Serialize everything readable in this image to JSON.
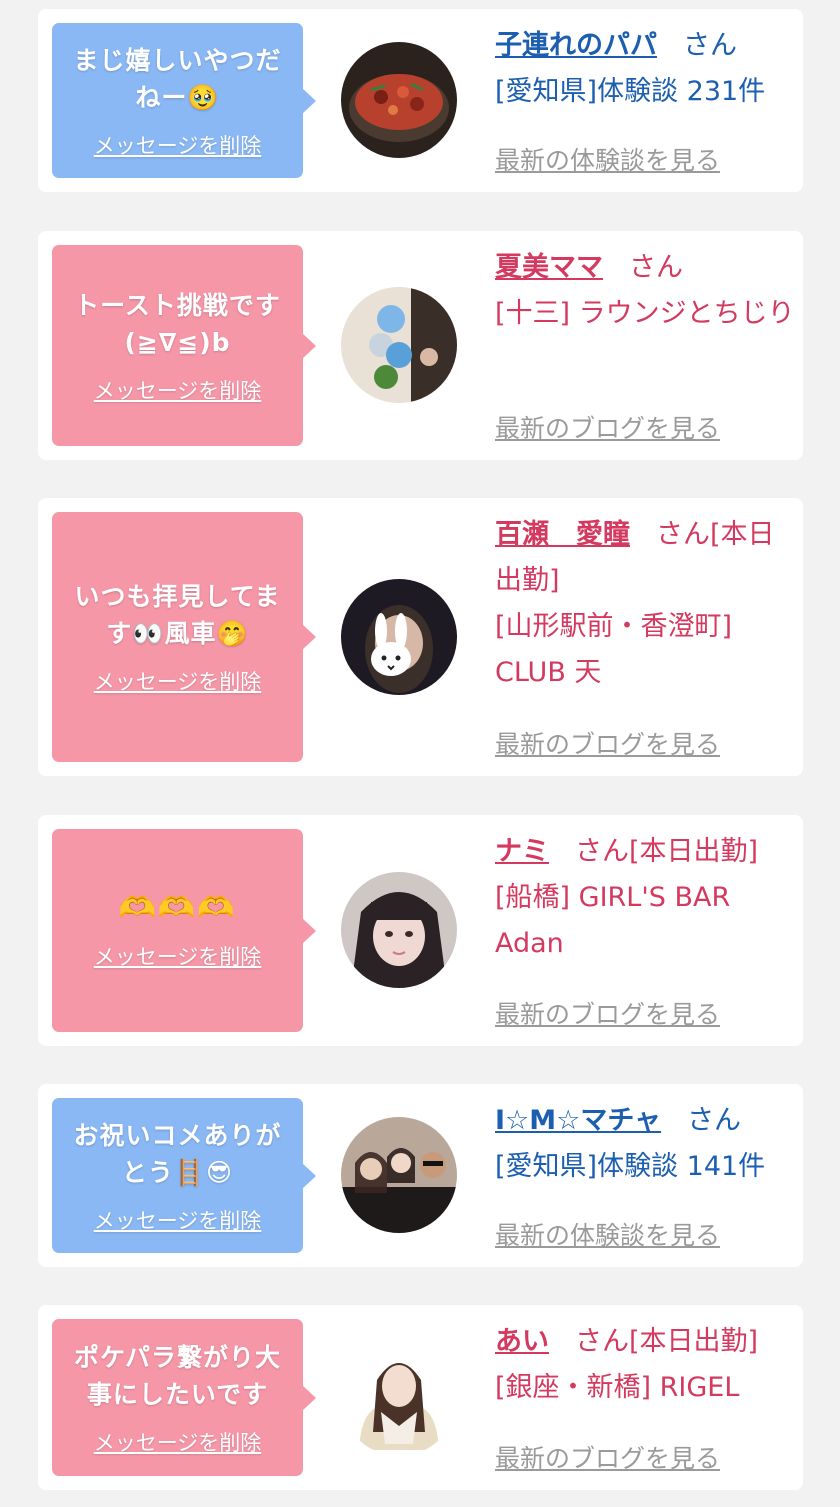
{
  "ui": {
    "delete_label": "メッセージを削除",
    "san": "さん"
  },
  "cards": [
    {
      "kind": "blue",
      "message": "まじ嬉しいやつだ\nねー🥹",
      "name": "子連れのパパ",
      "status": "",
      "sub": "[愛知県]体験談 231件",
      "latest_label": "最新の体験談を見る"
    },
    {
      "kind": "pink",
      "message": "トースト挑戦です\n(≧∇≦)b",
      "name": "夏美ママ",
      "status": "",
      "sub": "[十三] ラウンジとちじり",
      "latest_label": "最新のブログを見る"
    },
    {
      "kind": "pink",
      "message": "いつも拝見してま\nす👀風車🤭",
      "name": "百瀬　愛瞳",
      "status": "[本日出勤]",
      "sub": "[山形駅前・香澄町] CLUB 天",
      "latest_label": "最新のブログを見る"
    },
    {
      "kind": "pink",
      "message": "🫶🫶🫶",
      "name": "ナミ",
      "status": "[本日出勤]",
      "sub": "[船橋] GIRL'S BAR Adan",
      "latest_label": "最新のブログを見る"
    },
    {
      "kind": "blue",
      "message": "お祝いコメありが\nとう🪜😎",
      "name": "I☆M☆マチャ",
      "status": "",
      "sub": "[愛知県]体験談 141件",
      "latest_label": "最新の体験談を見る"
    },
    {
      "kind": "pink",
      "message": "ポケパラ繋がり大\n事にしたいです",
      "name": "あい",
      "status": "[本日出勤]",
      "sub": "[銀座・新橋] RIGEL",
      "latest_label": "最新のブログを見る"
    }
  ],
  "colors": {
    "blue_bubble": "#8ab8f4",
    "pink_bubble": "#f697a8",
    "blue_text": "#1c5fb0",
    "pink_text": "#d43a5f",
    "link_gray": "#9a9a9a"
  }
}
